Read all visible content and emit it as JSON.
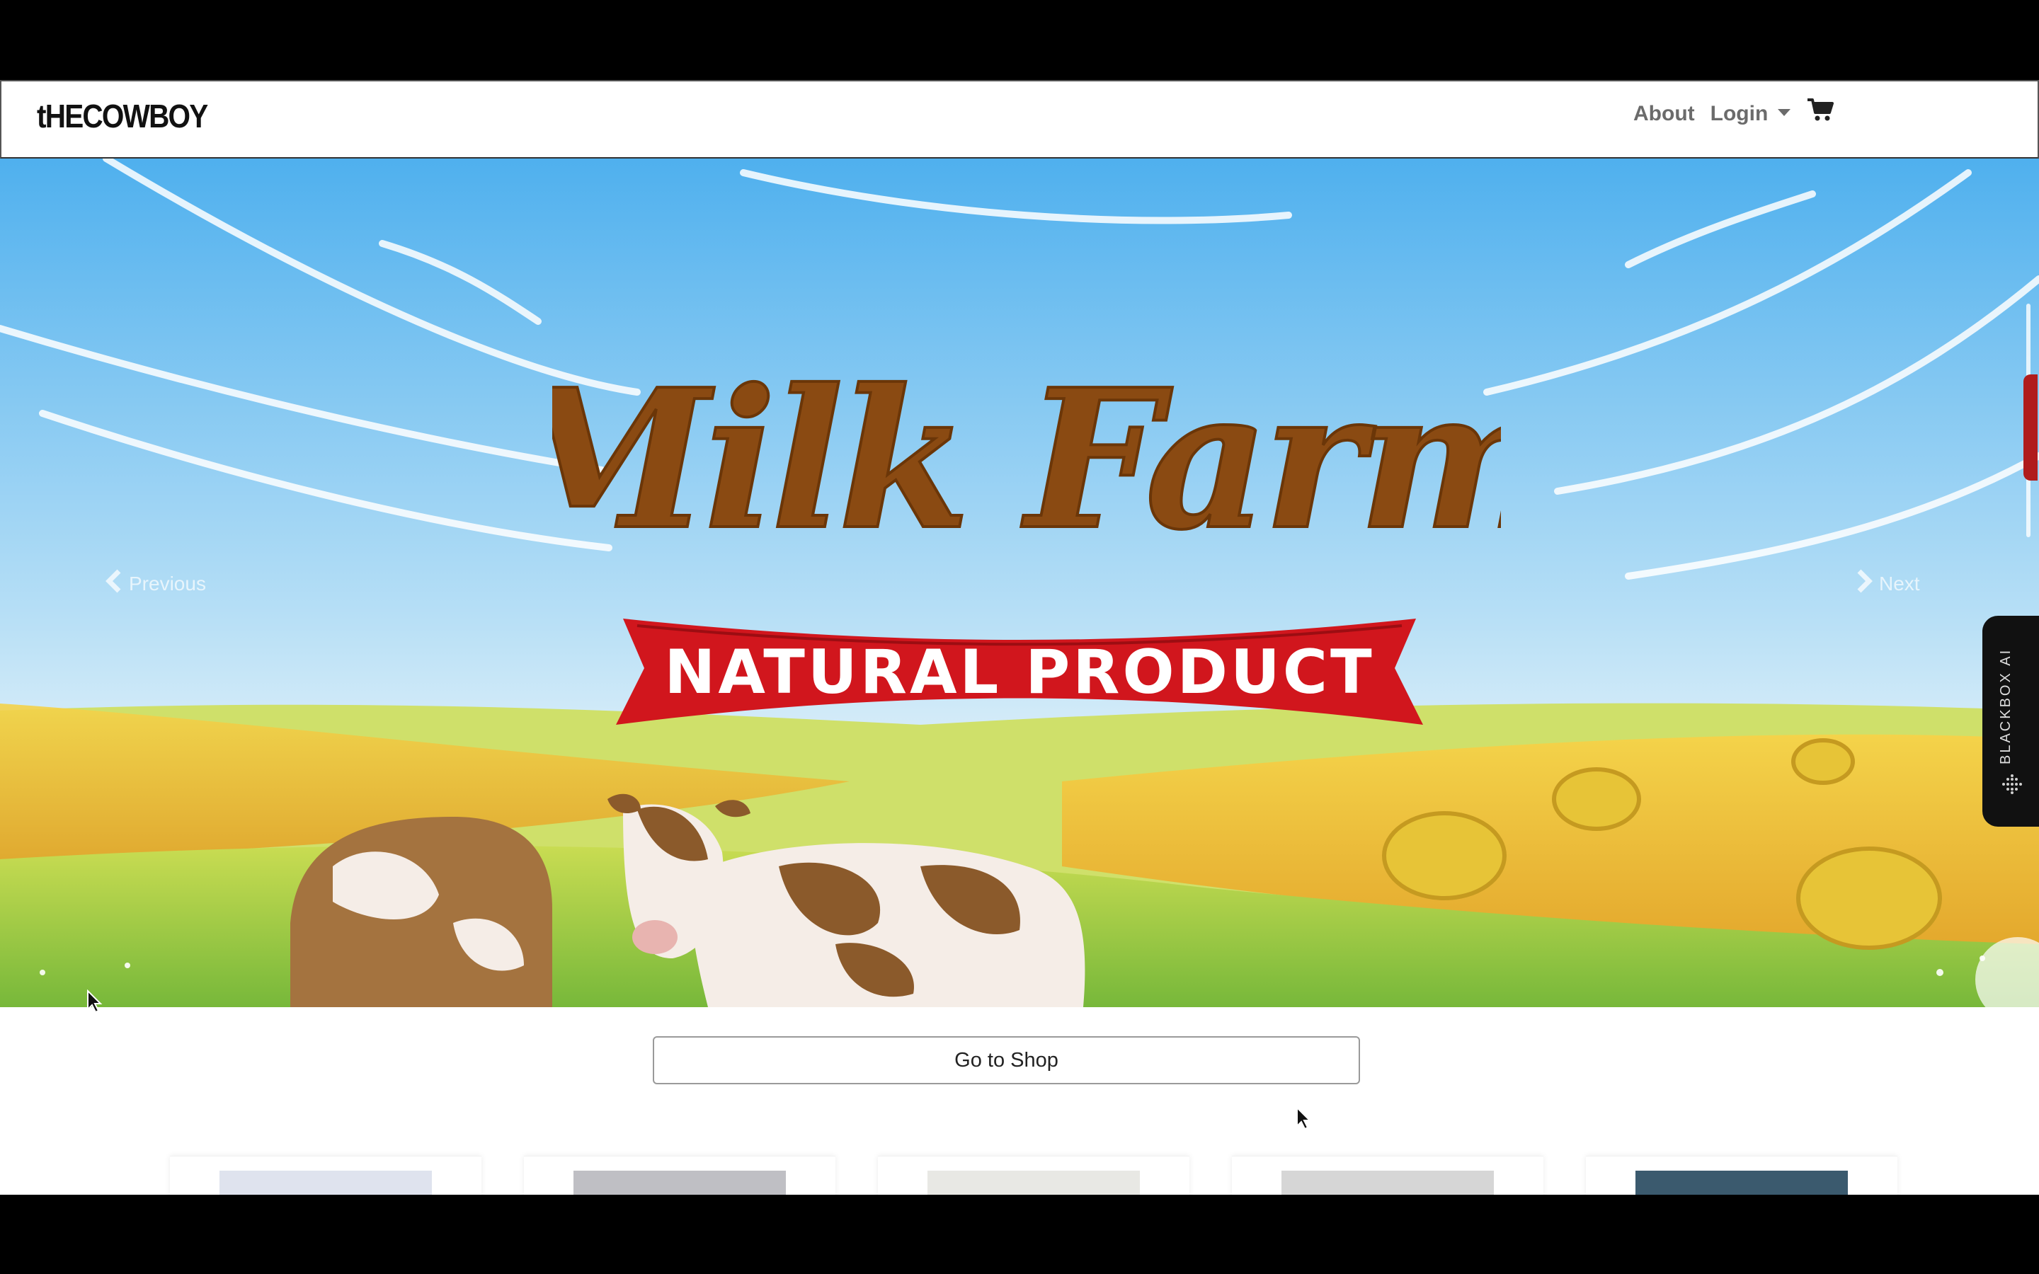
{
  "navbar": {
    "brand": "tHECOWBOY",
    "links": {
      "about": "About",
      "login": "Login"
    },
    "cart_icon": "shopping-cart-icon"
  },
  "hero": {
    "title": "Milk Farm",
    "ribbon_text": "NATURAL PRODUCT",
    "prev_label": "Previous",
    "next_label": "Next",
    "colors": {
      "title": "#8a4a12",
      "ribbon": "#d1161d",
      "sky": "#5ab6ee",
      "field": "#e8c23a"
    }
  },
  "side_widget": {
    "label": "BLACKBOX AI"
  },
  "shop_button": {
    "label": "Go to Shop"
  },
  "product_cards": [
    {
      "thumb_color": "#dfe3ee"
    },
    {
      "thumb_color": "#bfbfc4"
    },
    {
      "thumb_color": "#e8e8e4"
    },
    {
      "thumb_color": "#d6d6d6"
    },
    {
      "thumb_color": "#3b5a6e"
    }
  ]
}
